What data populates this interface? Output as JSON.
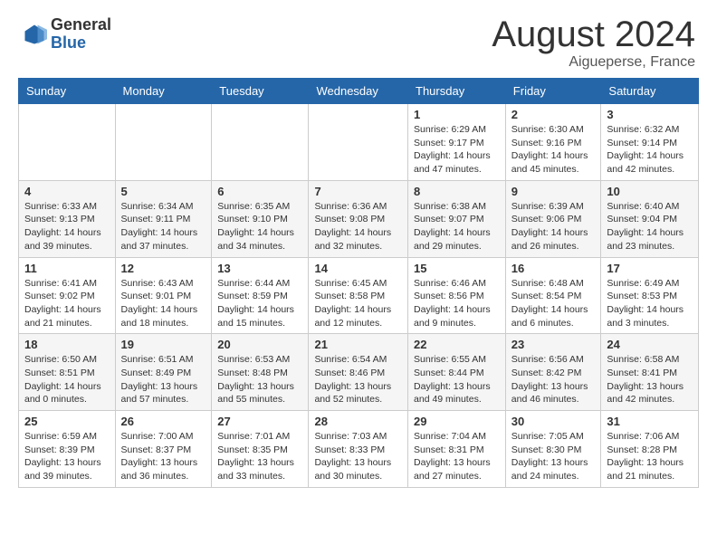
{
  "logo": {
    "general": "General",
    "blue": "Blue"
  },
  "header": {
    "month": "August 2024",
    "location": "Aigueperse, France"
  },
  "weekdays": [
    "Sunday",
    "Monday",
    "Tuesday",
    "Wednesday",
    "Thursday",
    "Friday",
    "Saturday"
  ],
  "weeks": [
    [
      {
        "day": "",
        "info": ""
      },
      {
        "day": "",
        "info": ""
      },
      {
        "day": "",
        "info": ""
      },
      {
        "day": "",
        "info": ""
      },
      {
        "day": "1",
        "info": "Sunrise: 6:29 AM\nSunset: 9:17 PM\nDaylight: 14 hours\nand 47 minutes."
      },
      {
        "day": "2",
        "info": "Sunrise: 6:30 AM\nSunset: 9:16 PM\nDaylight: 14 hours\nand 45 minutes."
      },
      {
        "day": "3",
        "info": "Sunrise: 6:32 AM\nSunset: 9:14 PM\nDaylight: 14 hours\nand 42 minutes."
      }
    ],
    [
      {
        "day": "4",
        "info": "Sunrise: 6:33 AM\nSunset: 9:13 PM\nDaylight: 14 hours\nand 39 minutes."
      },
      {
        "day": "5",
        "info": "Sunrise: 6:34 AM\nSunset: 9:11 PM\nDaylight: 14 hours\nand 37 minutes."
      },
      {
        "day": "6",
        "info": "Sunrise: 6:35 AM\nSunset: 9:10 PM\nDaylight: 14 hours\nand 34 minutes."
      },
      {
        "day": "7",
        "info": "Sunrise: 6:36 AM\nSunset: 9:08 PM\nDaylight: 14 hours\nand 32 minutes."
      },
      {
        "day": "8",
        "info": "Sunrise: 6:38 AM\nSunset: 9:07 PM\nDaylight: 14 hours\nand 29 minutes."
      },
      {
        "day": "9",
        "info": "Sunrise: 6:39 AM\nSunset: 9:06 PM\nDaylight: 14 hours\nand 26 minutes."
      },
      {
        "day": "10",
        "info": "Sunrise: 6:40 AM\nSunset: 9:04 PM\nDaylight: 14 hours\nand 23 minutes."
      }
    ],
    [
      {
        "day": "11",
        "info": "Sunrise: 6:41 AM\nSunset: 9:02 PM\nDaylight: 14 hours\nand 21 minutes."
      },
      {
        "day": "12",
        "info": "Sunrise: 6:43 AM\nSunset: 9:01 PM\nDaylight: 14 hours\nand 18 minutes."
      },
      {
        "day": "13",
        "info": "Sunrise: 6:44 AM\nSunset: 8:59 PM\nDaylight: 14 hours\nand 15 minutes."
      },
      {
        "day": "14",
        "info": "Sunrise: 6:45 AM\nSunset: 8:58 PM\nDaylight: 14 hours\nand 12 minutes."
      },
      {
        "day": "15",
        "info": "Sunrise: 6:46 AM\nSunset: 8:56 PM\nDaylight: 14 hours\nand 9 minutes."
      },
      {
        "day": "16",
        "info": "Sunrise: 6:48 AM\nSunset: 8:54 PM\nDaylight: 14 hours\nand 6 minutes."
      },
      {
        "day": "17",
        "info": "Sunrise: 6:49 AM\nSunset: 8:53 PM\nDaylight: 14 hours\nand 3 minutes."
      }
    ],
    [
      {
        "day": "18",
        "info": "Sunrise: 6:50 AM\nSunset: 8:51 PM\nDaylight: 14 hours\nand 0 minutes."
      },
      {
        "day": "19",
        "info": "Sunrise: 6:51 AM\nSunset: 8:49 PM\nDaylight: 13 hours\nand 57 minutes."
      },
      {
        "day": "20",
        "info": "Sunrise: 6:53 AM\nSunset: 8:48 PM\nDaylight: 13 hours\nand 55 minutes."
      },
      {
        "day": "21",
        "info": "Sunrise: 6:54 AM\nSunset: 8:46 PM\nDaylight: 13 hours\nand 52 minutes."
      },
      {
        "day": "22",
        "info": "Sunrise: 6:55 AM\nSunset: 8:44 PM\nDaylight: 13 hours\nand 49 minutes."
      },
      {
        "day": "23",
        "info": "Sunrise: 6:56 AM\nSunset: 8:42 PM\nDaylight: 13 hours\nand 46 minutes."
      },
      {
        "day": "24",
        "info": "Sunrise: 6:58 AM\nSunset: 8:41 PM\nDaylight: 13 hours\nand 42 minutes."
      }
    ],
    [
      {
        "day": "25",
        "info": "Sunrise: 6:59 AM\nSunset: 8:39 PM\nDaylight: 13 hours\nand 39 minutes."
      },
      {
        "day": "26",
        "info": "Sunrise: 7:00 AM\nSunset: 8:37 PM\nDaylight: 13 hours\nand 36 minutes."
      },
      {
        "day": "27",
        "info": "Sunrise: 7:01 AM\nSunset: 8:35 PM\nDaylight: 13 hours\nand 33 minutes."
      },
      {
        "day": "28",
        "info": "Sunrise: 7:03 AM\nSunset: 8:33 PM\nDaylight: 13 hours\nand 30 minutes."
      },
      {
        "day": "29",
        "info": "Sunrise: 7:04 AM\nSunset: 8:31 PM\nDaylight: 13 hours\nand 27 minutes."
      },
      {
        "day": "30",
        "info": "Sunrise: 7:05 AM\nSunset: 8:30 PM\nDaylight: 13 hours\nand 24 minutes."
      },
      {
        "day": "31",
        "info": "Sunrise: 7:06 AM\nSunset: 8:28 PM\nDaylight: 13 hours\nand 21 minutes."
      }
    ]
  ]
}
